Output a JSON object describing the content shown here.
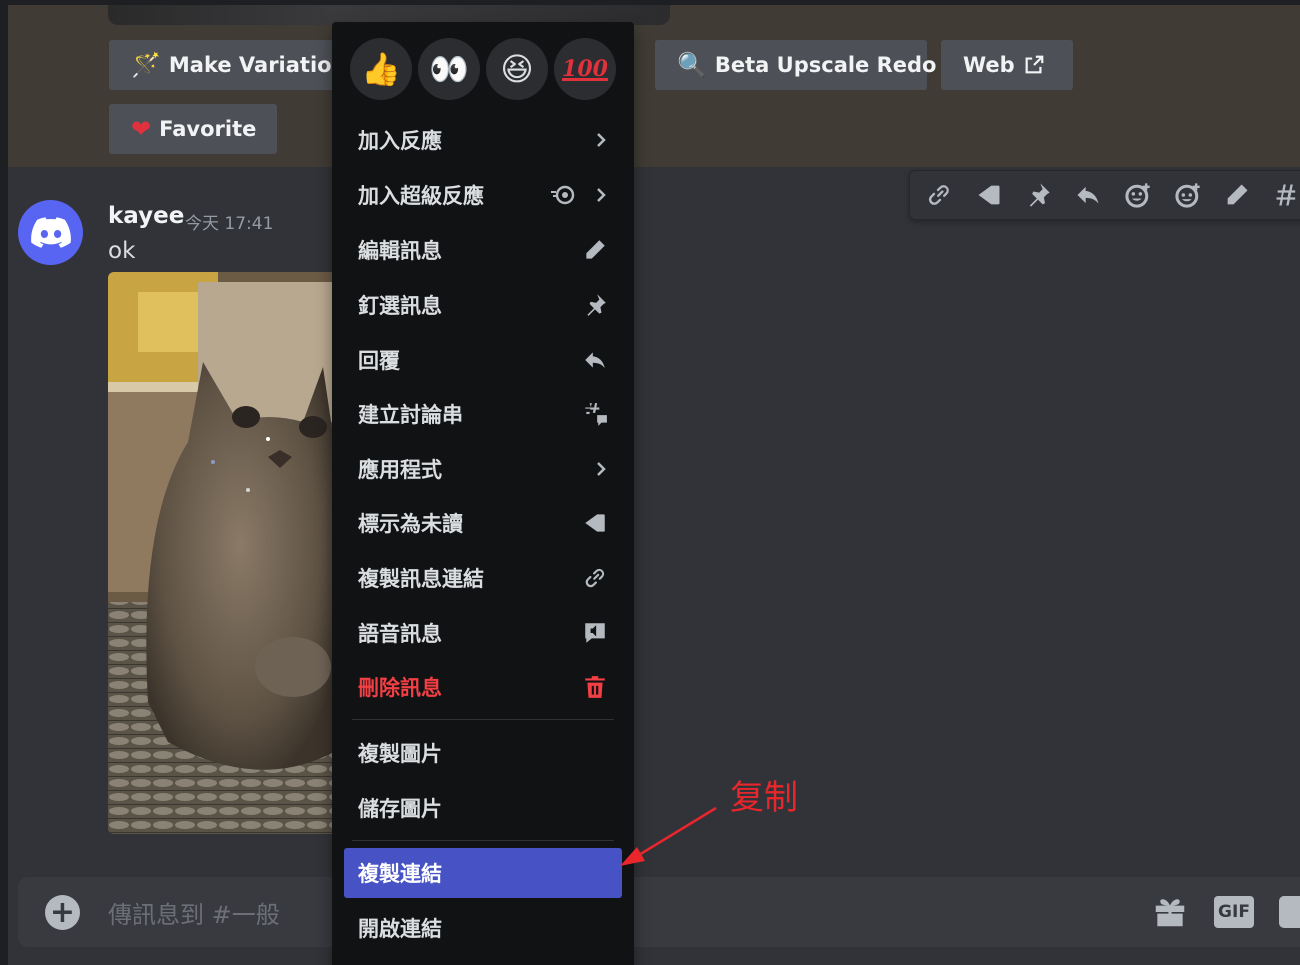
{
  "prev_message": {
    "buttons": {
      "make_variations": {
        "label": "Make Variations",
        "icon": "magic-wand-icon"
      },
      "beta_upscale_redo": {
        "label": "Beta Upscale Redo",
        "icon": "magnifier-icon"
      },
      "web": {
        "label": "Web",
        "icon": "external-link-icon"
      },
      "favorite": {
        "label": "Favorite",
        "icon": "heart-icon"
      }
    }
  },
  "message": {
    "username": "kayee",
    "timestamp": "今天 17:41",
    "text": "ok",
    "attachment": "cat-photo"
  },
  "hover_toolbar": {
    "icons": [
      "link-icon",
      "mark-unread-icon",
      "pin-icon",
      "reply-icon",
      "add-reaction-icon",
      "add-super-reaction-icon",
      "edit-icon",
      "create-thread-icon"
    ]
  },
  "context_menu": {
    "reactions": [
      "👍",
      "👀",
      "😆",
      "100"
    ],
    "items": {
      "add_reaction": "加入反應",
      "add_super_reaction": "加入超級反應",
      "edit_message": "編輯訊息",
      "pin_message": "釘選訊息",
      "reply": "回覆",
      "create_thread": "建立討論串",
      "apps": "應用程式",
      "mark_unread": "標示為未讀",
      "copy_message_link": "複製訊息連結",
      "speak_message": "語音訊息",
      "delete_message": "刪除訊息",
      "copy_image": "複製圖片",
      "save_image": "儲存圖片",
      "copy_link": "複製連結",
      "open_link": "開啟連結"
    },
    "highlighted": "copy_link"
  },
  "chat_input": {
    "placeholder": "傳訊息到 #一般",
    "gif_label": "GIF"
  },
  "annotation": {
    "label": "复制",
    "color": "#e8262b"
  },
  "colors": {
    "accent": "#4752c4",
    "danger": "#f23f43",
    "blurple": "#5865f2"
  }
}
